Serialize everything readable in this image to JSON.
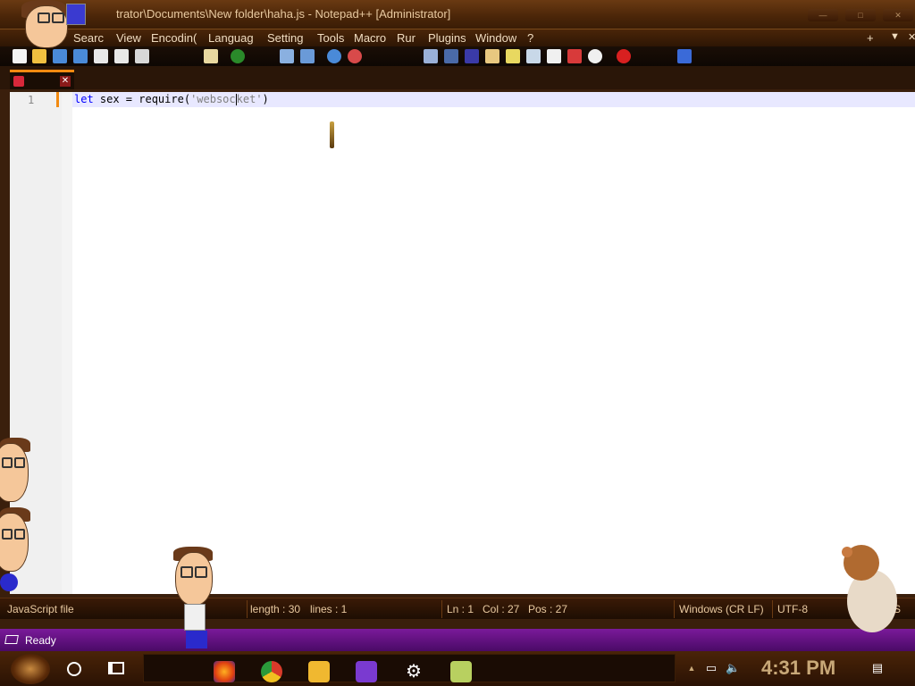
{
  "window": {
    "title": "trator\\Documents\\New folder\\haha.js - Notepad++ [Administrator]",
    "buttons": [
      "—",
      "□",
      "✕"
    ]
  },
  "menu": [
    "Searc",
    "View",
    "Encodin(",
    "Languag",
    "Setting",
    "Tools",
    "Macro",
    "Rur",
    "Plugins",
    "Window",
    "?"
  ],
  "menu_right": [
    "+",
    "▼",
    "✕"
  ],
  "editor": {
    "line_number": "1",
    "code": {
      "keyword": "let",
      "plain1": " sex = require(",
      "string_before_cursor": "'websoc",
      "string_after_cursor": "ket'",
      "plain2": ")"
    }
  },
  "status": {
    "file_type": "JavaScript file",
    "length": "length : 30",
    "lines": "lines : 1",
    "ln": "Ln : 1",
    "col": "Col : 27",
    "pos": "Pos : 27",
    "eol": "Windows (CR LF)",
    "encoding": "UTF-8",
    "mode": "S"
  },
  "ready": "Ready",
  "taskbar": {
    "clock": "4:31 PM",
    "apps": [
      "firefox-icon",
      "chrome-icon",
      "file-explorer-icon",
      "visual-studio-icon",
      "settings-icon",
      "notepadpp-icon"
    ]
  }
}
